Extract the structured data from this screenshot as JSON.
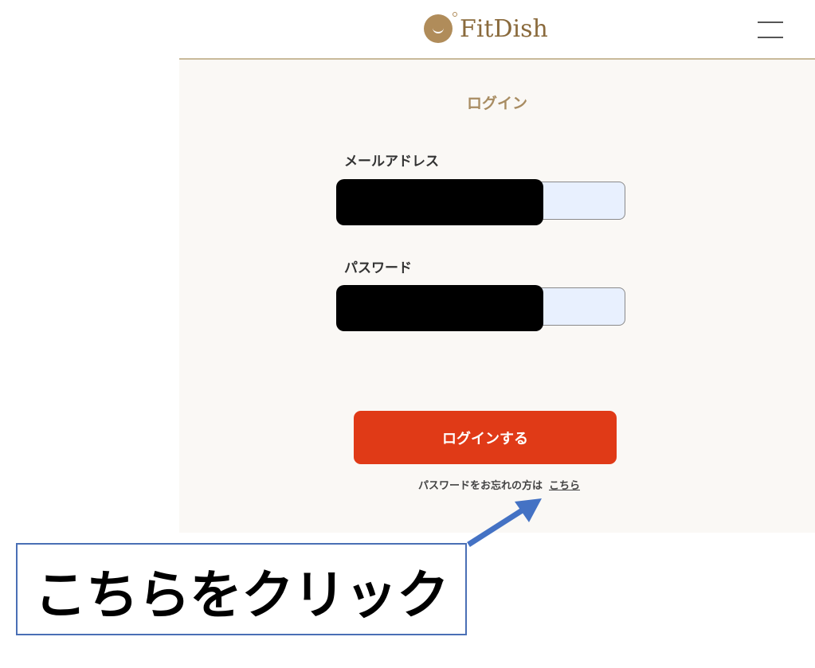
{
  "header": {
    "logo_text": "FitDish",
    "menu_icon": "hamburger-menu-icon"
  },
  "login_form": {
    "title": "ログイン",
    "email_label": "メールアドレス",
    "email_value": "",
    "password_label": "パスワード",
    "password_value": "",
    "submit_label": "ログインする",
    "forgot_text": "パスワードをお忘れの方は",
    "forgot_link": "こちら"
  },
  "annotation": {
    "callout_text": "こちらをクリック",
    "arrow_icon": "arrow-up-right-icon"
  },
  "colors": {
    "brand": "#8a6a3c",
    "accent_button": "#e03a17",
    "annotation_border": "#4a6fb5",
    "annotation_arrow": "#4472c4",
    "input_fill": "#e8f0fe"
  }
}
